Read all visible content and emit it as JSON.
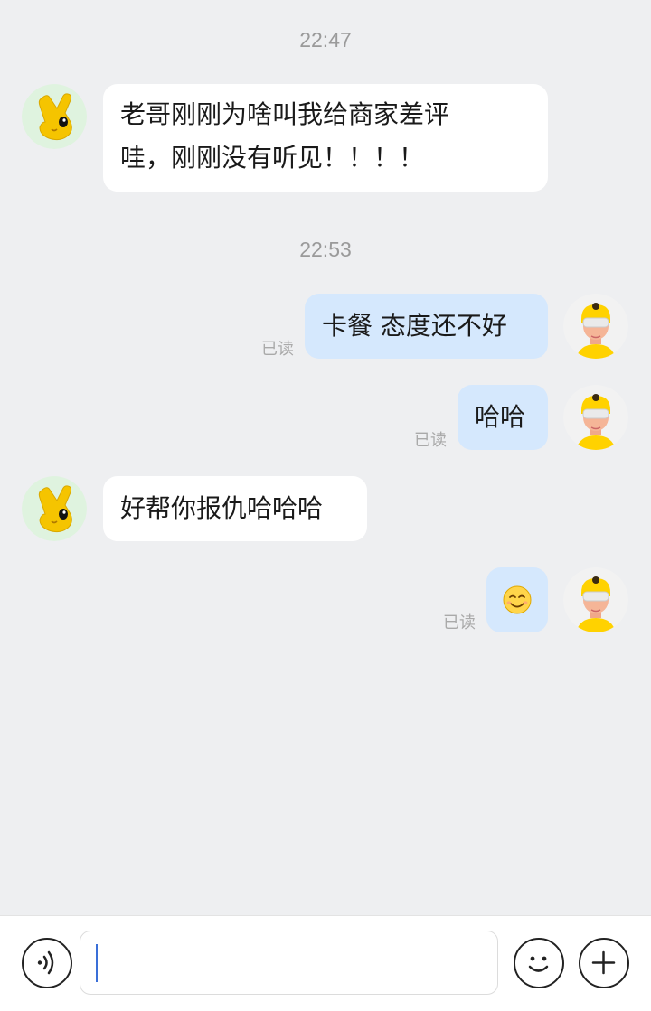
{
  "conversation": {
    "messages": [
      {
        "time": "22:47"
      },
      {
        "sender": "other",
        "avatar": "yellow-hand-mascot-icon",
        "lines": [
          "老哥刚刚为啥叫我给商家差评",
          "哇，刚刚没有听见！！！！"
        ]
      },
      {
        "time": "22:53"
      },
      {
        "sender": "me",
        "avatar": "courier-helmet-avatar-icon",
        "text": "卡餐 态度还不好",
        "status": "已读"
      },
      {
        "sender": "me",
        "avatar": "courier-helmet-avatar-icon",
        "text": "哈哈",
        "status": "已读"
      },
      {
        "sender": "other",
        "avatar": "yellow-hand-mascot-icon",
        "text": "好帮你报仇哈哈哈"
      },
      {
        "sender": "me",
        "avatar": "courier-helmet-avatar-icon",
        "emoji": "😊",
        "emoji_name": "smiling-face-emoji",
        "status": "已读"
      }
    ]
  },
  "input_bar": {
    "voice_button": "voice-input-icon",
    "text_value": "",
    "emoji_button": "emoji-face-icon",
    "more_button": "plus-icon"
  },
  "colors": {
    "background": "#eeeff1",
    "incoming_bubble": "#ffffff",
    "outgoing_bubble": "#d5e8fd",
    "mascot_yellow": "#f5c400",
    "caret": "#3a6fd8"
  }
}
